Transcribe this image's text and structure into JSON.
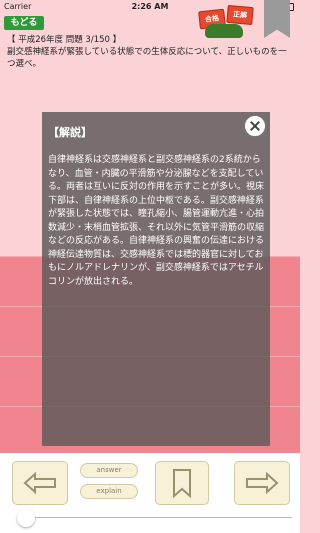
{
  "status": {
    "carrier": "Carrier",
    "time": "2:26 AM"
  },
  "nav": {
    "back_label": "もどる"
  },
  "seals": {
    "left": "合格",
    "right": "正解"
  },
  "question": {
    "header": "【 平成26年度 問題 3/150 】",
    "text": "副交感神経系が緊張している状態での生体反応について、正しいものを一つ選べ。"
  },
  "explanation": {
    "title": "【解説】",
    "body": "自律神経系は交感神経系と副交感神経系の2系統からなり、血管・内臓の平滑筋や分泌腺などを支配している。両者は互いに反対の作用を示すことが多い。視床下部は、自律神経系の上位中枢である。副交感神経系が緊張した状態では、瞳孔縮小、腸管運動亢進・心拍数減少・末梢血管拡張、それ以外に気管平滑筋の収縮などの反応がある。自律神経系の興奮の伝達における神経伝達物質は、交感神経系では標的器官に対しておもにノルアドレナリンが、副交感神経系ではアセチルコリンが放出される。",
    "faint_1": "",
    "faint_2": "",
    "faint_3": ""
  },
  "toolbar": {
    "answer_label": "answer",
    "explain_label": "explain"
  },
  "colors": {
    "answer_card": "#f08590",
    "back_button": "#2e9a3a",
    "slider": "#3a7ad8"
  },
  "slider": {
    "value": 0.0
  }
}
